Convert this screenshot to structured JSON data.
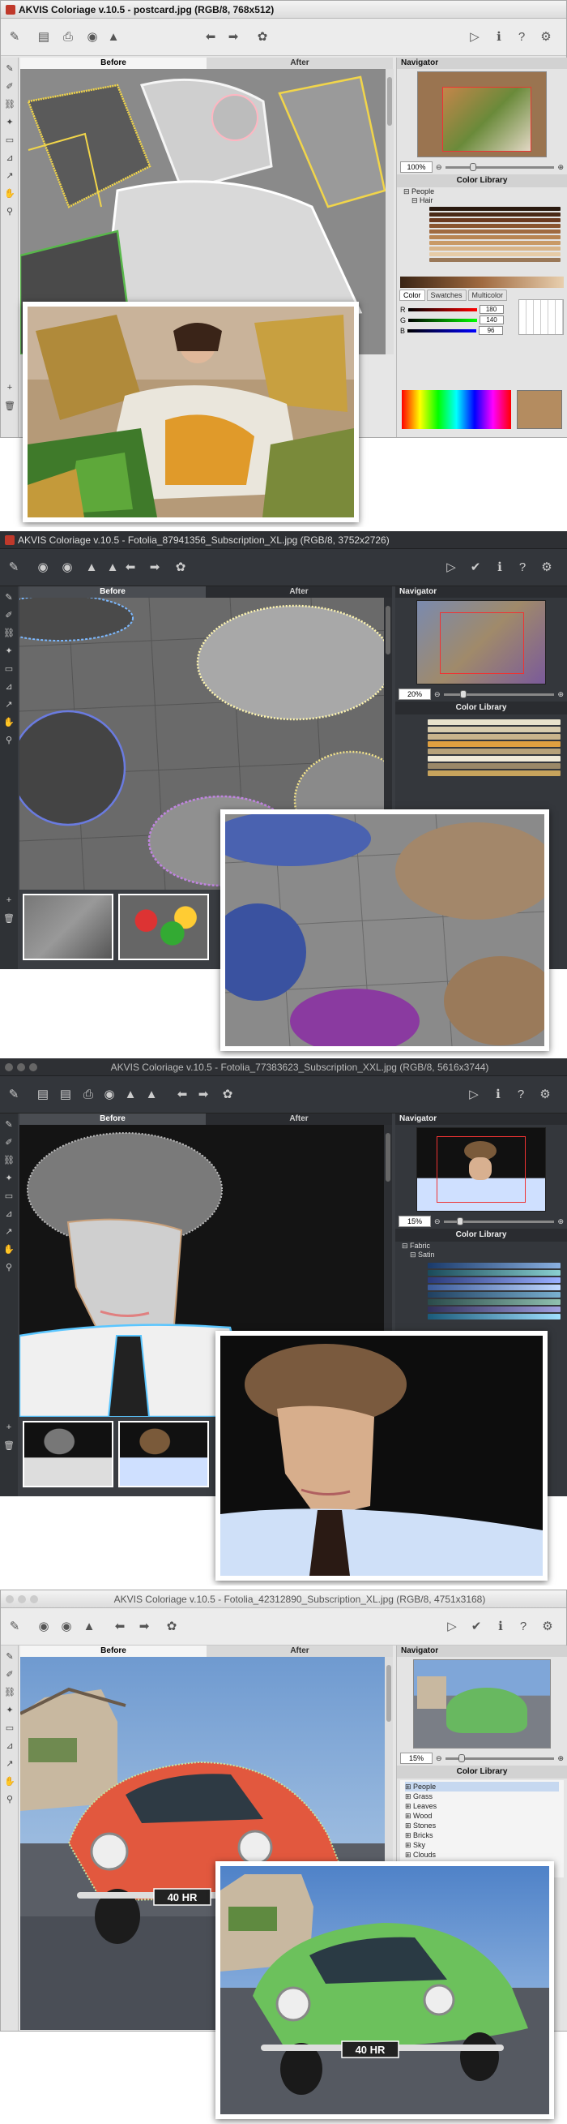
{
  "screens": [
    {
      "title": "AKVIS Coloriage v.10.5 - postcard.jpg (RGB/8, 768x512)",
      "tab_before": "Before",
      "tab_after": "After",
      "navigator_label": "Navigator",
      "zoom": "100%",
      "color_library_label": "Color Library",
      "tree": [
        "People",
        "Hair"
      ],
      "color_tabs": [
        "Color",
        "Swatches",
        "Multicolor"
      ],
      "rgb": {
        "r_label": "R",
        "g_label": "G",
        "b_label": "B",
        "r": "180",
        "g": "140",
        "b": "96"
      }
    },
    {
      "title": "AKVIS Coloriage v.10.5 - Fotolia_87941356_Subscription_XL.jpg (RGB/8, 3752x2726)",
      "tab_before": "Before",
      "tab_after": "After",
      "navigator_label": "Navigator",
      "zoom": "20%",
      "color_library_label": "Color Library"
    },
    {
      "title": "AKVIS Coloriage v.10.5 - Fotolia_77383623_Subscription_XXL.jpg (RGB/8, 5616x3744)",
      "tab_before": "Before",
      "tab_after": "After",
      "navigator_label": "Navigator",
      "zoom": "15%",
      "color_library_label": "Color Library",
      "tree": [
        "Fabric",
        "Satin"
      ]
    },
    {
      "title": "AKVIS Coloriage v.10.5 - Fotolia_42312890_Subscription_XL.jpg (RGB/8, 4751x3168)",
      "tab_before": "Before",
      "tab_after": "After",
      "navigator_label": "Navigator",
      "zoom": "15%",
      "color_library_label": "Color Library",
      "tree": [
        "People",
        "Grass",
        "Leaves",
        "Wood",
        "Stones",
        "Bricks",
        "Sky",
        "Clouds"
      ],
      "plate_text": "40 HR"
    }
  ],
  "colors": {
    "light_bg": "#e9e9e9",
    "dark_bg": "#3a3d42",
    "dark_panel": "#2b2d31",
    "accent_orange": "#e0a040"
  }
}
